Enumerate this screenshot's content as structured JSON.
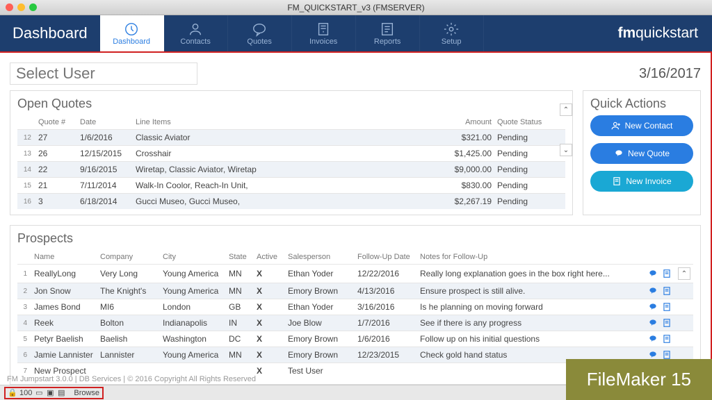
{
  "window_title": "FM_QUICKSTART_v3 (FMSERVER)",
  "brand_left": "Dashboard",
  "brand_right_bold": "fm",
  "brand_right_light": "quickstart",
  "tabs": {
    "dashboard": "Dashboard",
    "contacts": "Contacts",
    "quotes": "Quotes",
    "invoices": "Invoices",
    "reports": "Reports",
    "setup": "Setup"
  },
  "select_user_placeholder": "Select User",
  "page_date": "3/16/2017",
  "open_quotes": {
    "title": "Open Quotes",
    "headers": {
      "num": "Quote #",
      "date": "Date",
      "items": "Line Items",
      "amount": "Amount",
      "status": "Quote Status"
    },
    "rows": [
      {
        "n": "12",
        "id": "27",
        "date": "1/6/2016",
        "items": "Classic Aviator",
        "amount": "$321.00",
        "status": "Pending"
      },
      {
        "n": "13",
        "id": "26",
        "date": "12/15/2015",
        "items": "Crosshair",
        "amount": "$1,425.00",
        "status": "Pending"
      },
      {
        "n": "14",
        "id": "22",
        "date": "9/16/2015",
        "items": "Wiretap, Classic Aviator, Wiretap",
        "amount": "$9,000.00",
        "status": "Pending"
      },
      {
        "n": "15",
        "id": "21",
        "date": "7/11/2014",
        "items": "Walk-In Coolor, Reach-In Unit,",
        "amount": "$830.00",
        "status": "Pending"
      },
      {
        "n": "16",
        "id": "3",
        "date": "6/18/2014",
        "items": "Gucci Museo, Gucci Museo,",
        "amount": "$2,267.19",
        "status": "Pending"
      }
    ]
  },
  "quick_actions": {
    "title": "Quick Actions",
    "new_contact": "New Contact",
    "new_quote": "New Quote",
    "new_invoice": "New Invoice"
  },
  "prospects": {
    "title": "Prospects",
    "headers": {
      "name": "Name",
      "company": "Company",
      "city": "City",
      "state": "State",
      "active": "Active",
      "sales": "Salesperson",
      "follow": "Follow-Up Date",
      "notes": "Notes for Follow-Up"
    },
    "rows": [
      {
        "n": "1",
        "name": "ReallyLong",
        "company": "Very Long",
        "city": "Young America",
        "state": "MN",
        "active": "X",
        "sales": "Ethan Yoder",
        "follow": "12/22/2016",
        "notes": "Really long explanation goes in the box right here..."
      },
      {
        "n": "2",
        "name": "Jon Snow",
        "company": "The Knight's",
        "city": "Young America",
        "state": "MN",
        "active": "X",
        "sales": "Emory Brown",
        "follow": "4/13/2016",
        "notes": "Ensure prospect is still alive."
      },
      {
        "n": "3",
        "name": "James Bond",
        "company": "MI6",
        "city": "London",
        "state": "GB",
        "active": "X",
        "sales": "Ethan Yoder",
        "follow": "3/16/2016",
        "notes": "Is he planning on moving forward"
      },
      {
        "n": "4",
        "name": "Reek",
        "company": "Bolton",
        "city": "Indianapolis",
        "state": "IN",
        "active": "X",
        "sales": "Joe Blow",
        "follow": "1/7/2016",
        "notes": "See if there is any progress"
      },
      {
        "n": "5",
        "name": "Petyr Baelish",
        "company": "Baelish",
        "city": "Washington",
        "state": "DC",
        "active": "X",
        "sales": "Emory Brown",
        "follow": "1/6/2016",
        "notes": "Follow up on his initial questions"
      },
      {
        "n": "6",
        "name": "Jamie Lannister",
        "company": "Lannister",
        "city": "Young America",
        "state": "MN",
        "active": "X",
        "sales": "Emory Brown",
        "follow": "12/23/2015",
        "notes": "Check gold hand status"
      },
      {
        "n": "7",
        "name": "New Prospect",
        "company": "",
        "city": "",
        "state": "",
        "active": "X",
        "sales": "Test User",
        "follow": "",
        "notes": ""
      }
    ]
  },
  "footer_text": "FM Jumpstart 3.0.0  | DB Services  | © 2016 Copyright All Rights Reserved",
  "statusbar": {
    "zoom": "100",
    "mode": "Browse"
  },
  "badge": "FileMaker 15"
}
